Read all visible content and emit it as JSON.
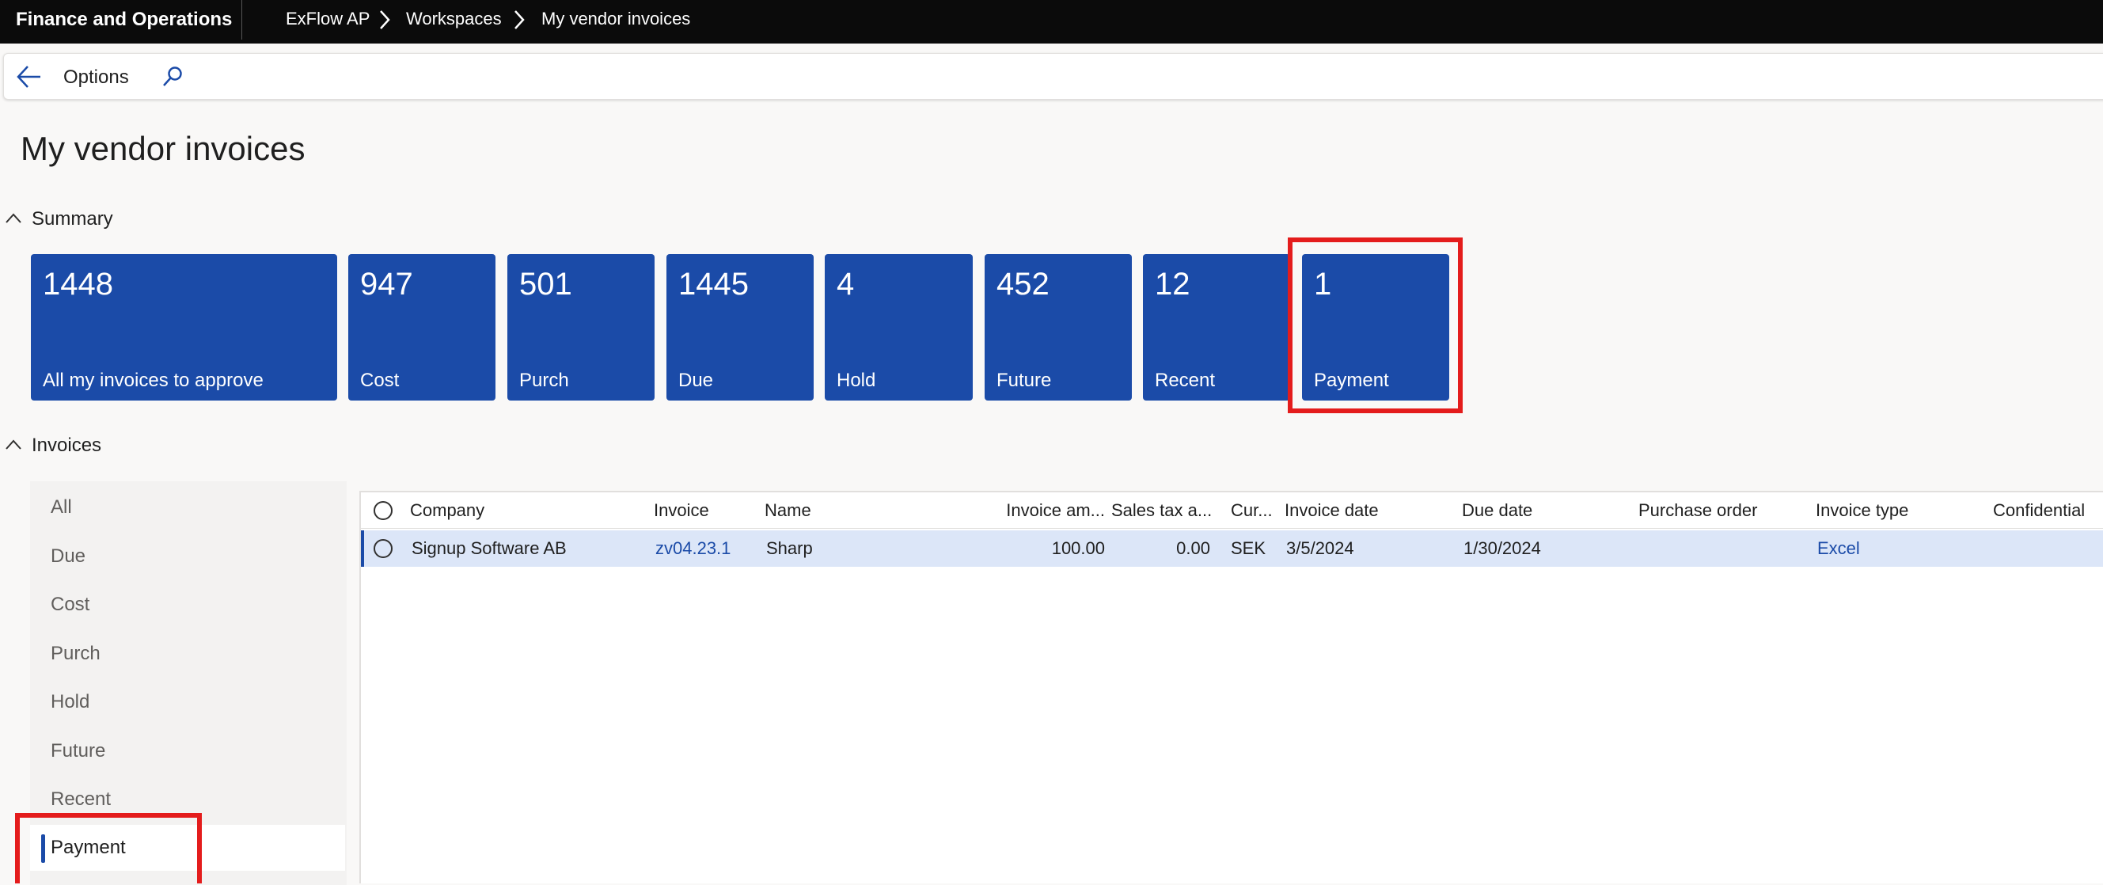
{
  "topbar": {
    "app_name": "Finance and Operations",
    "breadcrumbs": [
      "ExFlow AP",
      "Workspaces",
      "My vendor invoices"
    ]
  },
  "actionbar": {
    "options_label": "Options"
  },
  "page_title": "My vendor invoices",
  "summary": {
    "label": "Summary",
    "tiles": [
      {
        "count": "1448",
        "label": "All my invoices to approve"
      },
      {
        "count": "947",
        "label": "Cost"
      },
      {
        "count": "501",
        "label": "Purch"
      },
      {
        "count": "1445",
        "label": "Due"
      },
      {
        "count": "4",
        "label": "Hold"
      },
      {
        "count": "452",
        "label": "Future"
      },
      {
        "count": "12",
        "label": "Recent"
      },
      {
        "count": "1",
        "label": "Payment"
      }
    ]
  },
  "invoices": {
    "label": "Invoices",
    "filters": [
      "All",
      "Due",
      "Cost",
      "Purch",
      "Hold",
      "Future",
      "Recent",
      "Payment"
    ],
    "selected_filter": "Payment",
    "columns": [
      "Company",
      "Invoice",
      "Name",
      "Invoice am...",
      "Sales tax a...",
      "Cur...",
      "Invoice date",
      "Due date",
      "Purchase order",
      "Invoice type",
      "Confidential"
    ],
    "rows": [
      {
        "company": "Signup Software AB",
        "invoice": "zv04.23.1",
        "name": "Sharp",
        "invoice_amount": "100.00",
        "sales_tax": "0.00",
        "currency": "SEK",
        "invoice_date": "3/5/2024",
        "due_date": "1/30/2024",
        "purchase_order": "",
        "invoice_type": "Excel",
        "confidential": ""
      }
    ]
  },
  "colors": {
    "tile": "#1b4ba8",
    "highlight": "#e41c1c",
    "selected_row": "#dce6f8",
    "topbar": "#0b0b0b"
  }
}
